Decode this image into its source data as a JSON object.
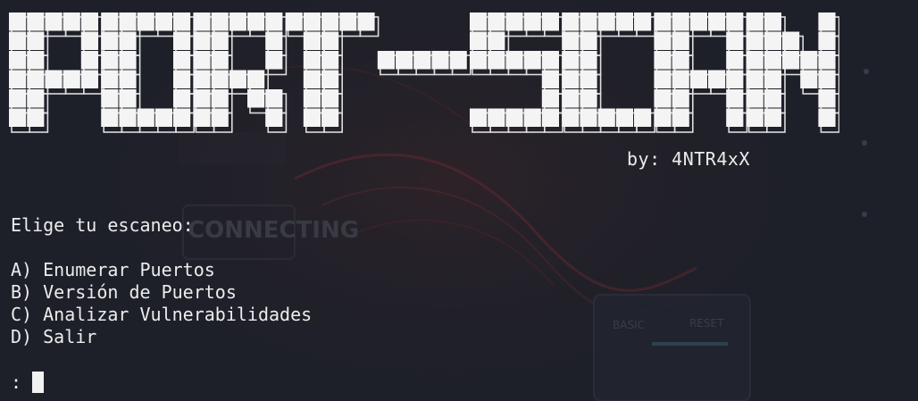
{
  "terminal": {
    "banner_text": "PORT-SCAN",
    "author": "by: 4NTR4xX",
    "prompt_title": "Elige tu escaneo:",
    "menu": [
      {
        "key": "A)",
        "label": "Enumerar Puertos"
      },
      {
        "key": "B)",
        "label": "Versión de Puertos"
      },
      {
        "key": "C)",
        "label": "Analizar Vulnerabilidades"
      },
      {
        "key": "D)",
        "label": "Salir"
      }
    ],
    "input_prompt": ":",
    "input_value": ""
  },
  "background": {
    "text": [
      "CONNECTING",
      "BASIC",
      "RESET"
    ]
  },
  "colors": {
    "background": "#1e2029",
    "text": "#ececec",
    "banner_fill": "#f4f4f4",
    "banner_shadow": "#dcdcdc",
    "art_accent": "#7a2a2e"
  }
}
